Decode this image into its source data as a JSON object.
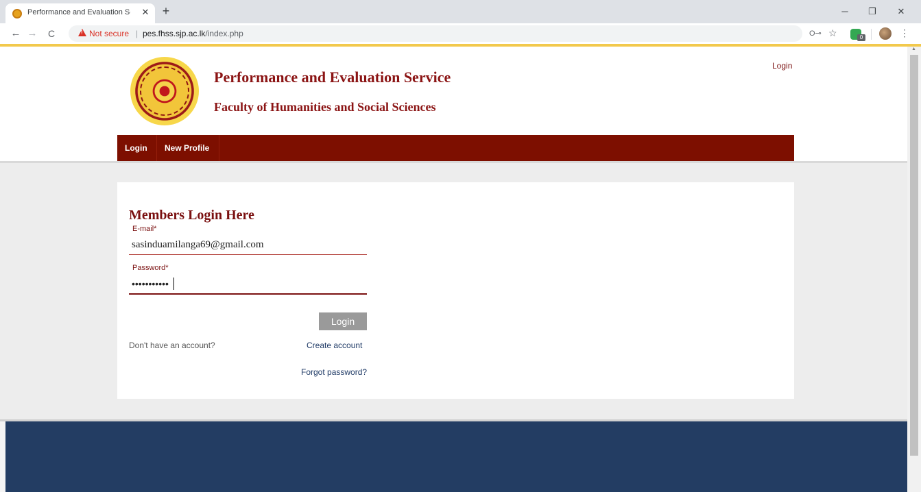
{
  "browser": {
    "tab_title": "Performance and Evaluation Serv",
    "tab_close": "✕",
    "new_tab": "+",
    "window_min": "─",
    "window_max": "❐",
    "window_close": "✕",
    "nav_back": "←",
    "nav_forward": "→",
    "nav_reload": "C",
    "security_text": "Not secure",
    "separator": "|",
    "url_host": "pes.fhss.sjp.ac.lk",
    "url_path": "/index.php",
    "key_icon": "O⊸",
    "star_icon": "☆",
    "extension_badge": "0",
    "menu_icon": "⋮",
    "load_bar_color": "#f2c94c"
  },
  "header": {
    "title": "Performance and Evaluation Service",
    "subtitle": "Faculty of Humanities and Social Sciences",
    "top_login_link": "Login",
    "logo_icon": "university-seal-icon"
  },
  "nav": {
    "items": [
      {
        "label": "Login"
      },
      {
        "label": "New Profile"
      }
    ],
    "color": "#7d0f00"
  },
  "login_form": {
    "title": "Members Login Here",
    "email_label": "E-mail*",
    "email_value": "sasinduamilanga69@gmail.com",
    "password_label": "Password*",
    "password_value": "•••••••••••",
    "login_button": "Login",
    "no_account_text": "Don't have an account?",
    "create_account_link": "Create account",
    "forgot_password_link": "Forgot password?"
  },
  "colors": {
    "brand_red": "#8b1414",
    "footer": "#233d63",
    "link": "#1f3a66"
  }
}
